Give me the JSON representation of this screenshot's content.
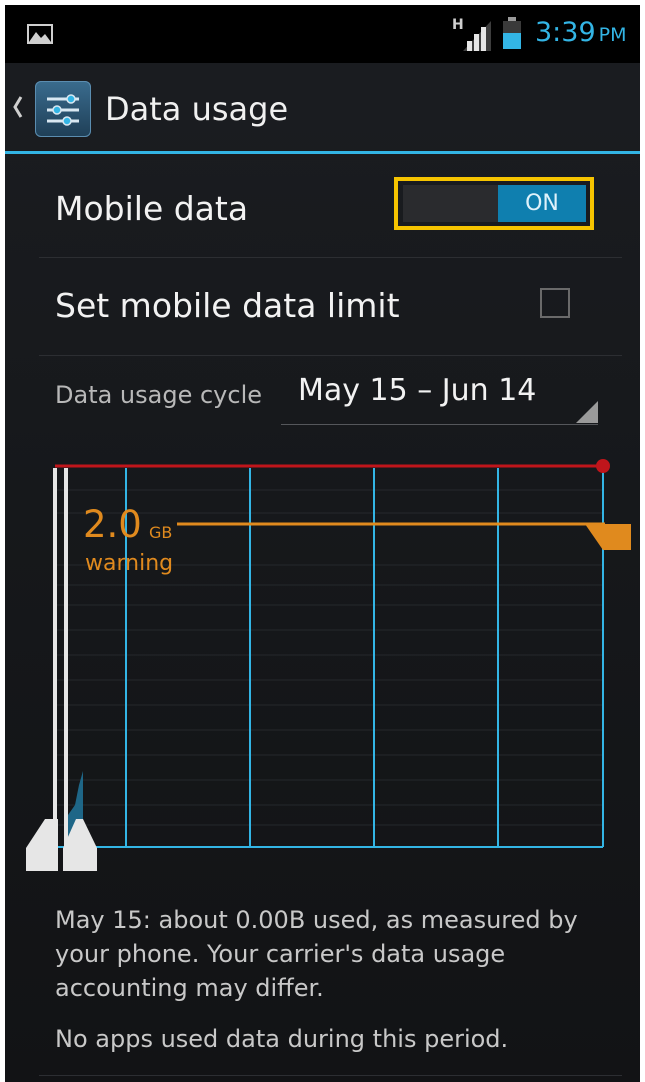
{
  "status_bar": {
    "network_type": "H",
    "time": "3:39",
    "ampm": "PM",
    "icons": [
      "gallery-icon",
      "signal-icon",
      "battery-icon"
    ],
    "accent_color": "#33b5e5"
  },
  "action_bar": {
    "title": "Data usage",
    "icons": [
      "back-icon",
      "data-usage-settings-icon"
    ]
  },
  "mobile_data": {
    "label": "Mobile data",
    "toggle_text": "ON",
    "state": "on"
  },
  "data_limit": {
    "label": "Set mobile data limit",
    "checked": false
  },
  "cycle": {
    "label": "Data usage cycle",
    "value": "May 15 – Jun 14"
  },
  "chart": {
    "warning_value": "2.0",
    "warning_unit": "GB",
    "warning_label": "warning",
    "colors": {
      "limit": "#c0151b",
      "warning": "#e08a1e",
      "grid": "#33b5e5"
    }
  },
  "summary": {
    "text": "May 15: about 0.00B used, as measured by your phone. Your carrier's data usage accounting may differ.",
    "no_apps": "No apps used data during this period."
  }
}
